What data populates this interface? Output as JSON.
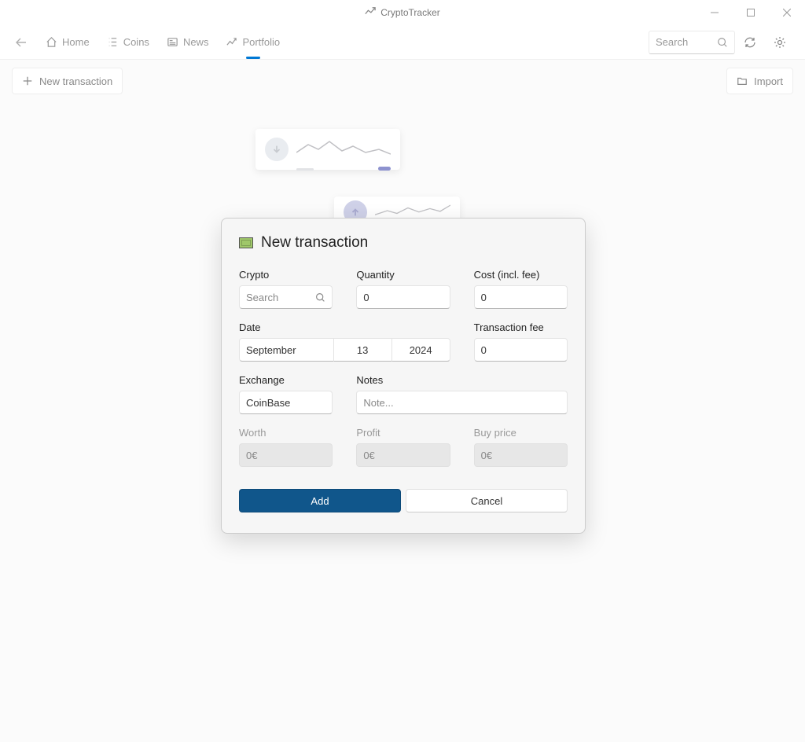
{
  "titlebar": {
    "app_name": "CryptoTracker"
  },
  "nav": {
    "items": [
      {
        "label": "Home"
      },
      {
        "label": "Coins"
      },
      {
        "label": "News"
      },
      {
        "label": "Portfolio"
      }
    ],
    "search_placeholder": "Search"
  },
  "toolbar": {
    "new_transaction": "New transaction",
    "import": "Import"
  },
  "dialog": {
    "title": "New transaction",
    "fields": {
      "crypto_label": "Crypto",
      "crypto_placeholder": "Search",
      "quantity_label": "Quantity",
      "quantity_value": "0",
      "cost_label": "Cost (incl. fee)",
      "cost_value": "0",
      "date_label": "Date",
      "date_month": "September",
      "date_day": "13",
      "date_year": "2024",
      "fee_label": "Transaction fee",
      "fee_value": "0",
      "exchange_label": "Exchange",
      "exchange_value": "CoinBase",
      "notes_label": "Notes",
      "notes_placeholder": "Note...",
      "worth_label": "Worth",
      "worth_value": "0€",
      "profit_label": "Profit",
      "profit_value": "0€",
      "buyprice_label": "Buy price",
      "buyprice_value": "0€"
    },
    "buttons": {
      "add": "Add",
      "cancel": "Cancel"
    }
  }
}
